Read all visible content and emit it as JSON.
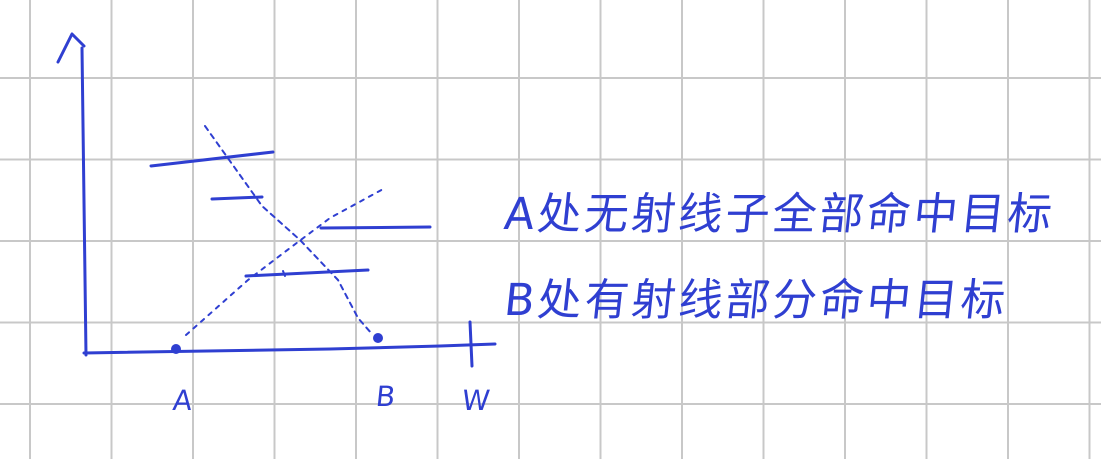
{
  "diagram": {
    "point_labels": {
      "a": "A",
      "b": "B",
      "axis_w": "W"
    },
    "notes": [
      "A处无射线子全部命中目标",
      "B处有射线部分命中目标"
    ],
    "colors": {
      "ink": "#2f3fd1",
      "grid": "#c8c8c8",
      "paper": "#ffffff"
    }
  }
}
